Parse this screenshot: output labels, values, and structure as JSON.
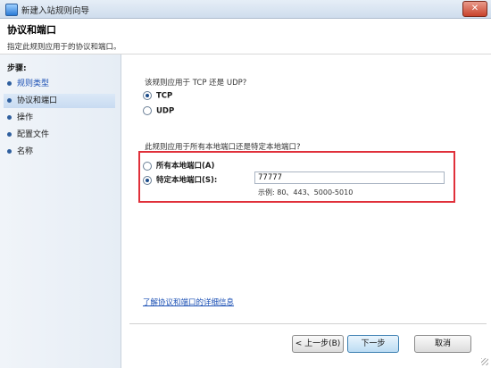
{
  "window": {
    "title": "新建入站规则向导",
    "close_glyph": "✕"
  },
  "header": {
    "title": "协议和端口",
    "description": "指定此规则应用于的协议和端口。"
  },
  "sidebar": {
    "steps_label": "步骤:",
    "items": [
      {
        "label": "规则类型",
        "state": "link"
      },
      {
        "label": "协议和端口",
        "state": "active"
      },
      {
        "label": "操作",
        "state": "normal"
      },
      {
        "label": "配置文件",
        "state": "normal"
      },
      {
        "label": "名称",
        "state": "normal"
      }
    ]
  },
  "protocol": {
    "question": "该规则应用于 TCP 还是 UDP?",
    "options": [
      {
        "label": "TCP",
        "checked": true
      },
      {
        "label": "UDP",
        "checked": false
      }
    ]
  },
  "ports": {
    "question": "此规则应用于所有本地端口还是特定本地端口?",
    "all_ports_label": "所有本地端口(A)",
    "specific_ports_label": "特定本地端口(S):",
    "specific_ports_value": "77777",
    "example": "示例: 80、443、5000-5010"
  },
  "learn_more_link": "了解协议和端口的详细信息",
  "buttons": {
    "back": "< 上一步(B)",
    "next": "下一步",
    "cancel": "取消"
  },
  "colors": {
    "highlight_border": "#e0303a",
    "link": "#1a4fb4"
  }
}
